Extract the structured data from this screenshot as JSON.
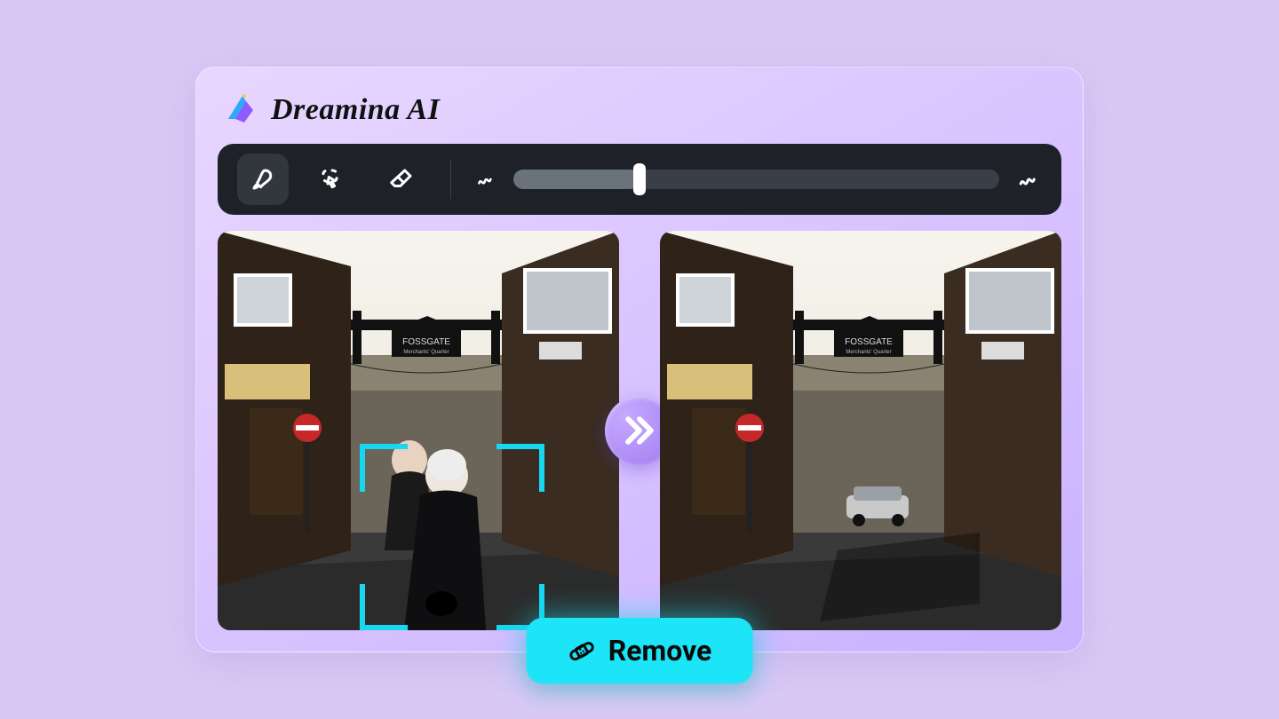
{
  "brand": {
    "title": "Dreamina AI"
  },
  "toolbar": {
    "tools": [
      {
        "name": "brush",
        "active": true
      },
      {
        "name": "lasso",
        "active": false
      },
      {
        "name": "eraser",
        "active": false
      }
    ],
    "slider": {
      "min_icon": "squiggle-thin",
      "max_icon": "squiggle-thick",
      "value_pct": 26
    }
  },
  "compare": {
    "left_alt": "Street photo with two people selected",
    "right_alt": "Street photo with people removed",
    "arrow_icon": "double-chevron-right"
  },
  "actions": {
    "remove_label": "Remove",
    "remove_icon": "bandage"
  }
}
